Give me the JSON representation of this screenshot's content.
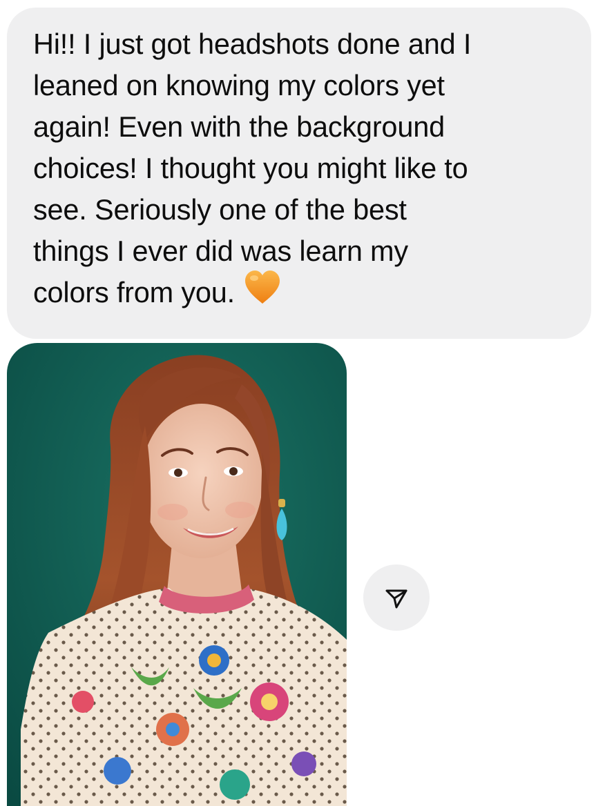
{
  "message": {
    "lines": [
      "Hi!! I just got headshots done and I",
      "leaned on knowing my colors yet",
      "again! Even with the background",
      "choices! I thought you might like to",
      "see. Seriously one of the best",
      "things I ever did was learn my",
      "colors from you."
    ],
    "emoji": "orange-heart-icon"
  },
  "attachment": {
    "type": "photo",
    "subject": "headshot"
  },
  "actions": {
    "share_icon": "send-icon"
  },
  "colors": {
    "bubble_bg": "#efeff0",
    "text": "#0d0d0d",
    "photo_backdrop": "#0f5a50",
    "heart": "#f49a25"
  }
}
